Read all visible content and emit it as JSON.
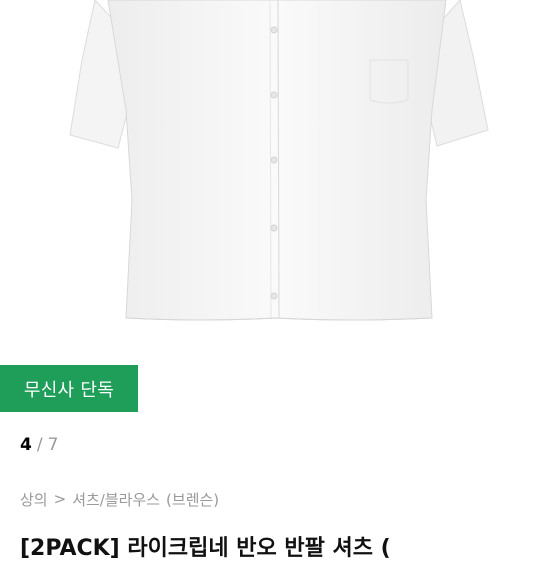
{
  "badge": {
    "label": "무신사 단독",
    "color": "#1f9e5a"
  },
  "pager": {
    "current": "4",
    "separator": "/",
    "total": "7"
  },
  "breadcrumb": {
    "category": "상의",
    "separator": ">",
    "subcategory": "셔츠/블라우스",
    "brand": "(브렌슨)"
  },
  "product": {
    "title": "[2PACK] 라이크립네 반오 반팔 셔츠 ("
  }
}
